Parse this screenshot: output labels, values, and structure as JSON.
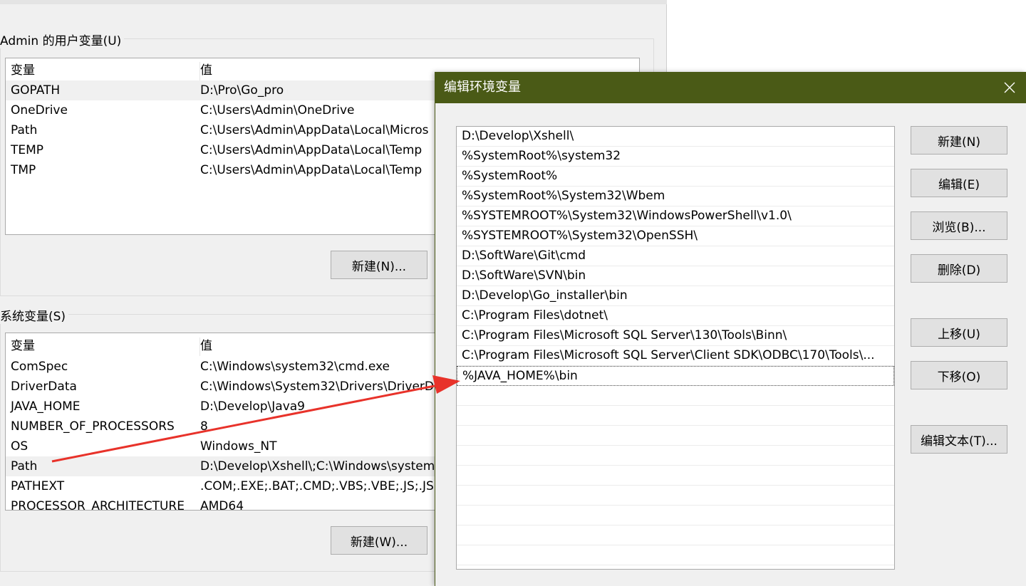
{
  "user_vars": {
    "label": "Admin 的用户变量(U)",
    "header": {
      "name": "变量",
      "value": "值"
    },
    "rows": [
      {
        "name": "GOPATH",
        "value": "D:\\Pro\\Go_pro"
      },
      {
        "name": "OneDrive",
        "value": "C:\\Users\\Admin\\OneDrive"
      },
      {
        "name": "Path",
        "value": "C:\\Users\\Admin\\AppData\\Local\\Micros"
      },
      {
        "name": "TEMP",
        "value": "C:\\Users\\Admin\\AppData\\Local\\Temp"
      },
      {
        "name": "TMP",
        "value": "C:\\Users\\Admin\\AppData\\Local\\Temp"
      }
    ],
    "new_button": "新建(N)..."
  },
  "system_vars": {
    "label": "系统变量(S)",
    "header": {
      "name": "变量",
      "value": "值"
    },
    "rows": [
      {
        "name": "ComSpec",
        "value": "C:\\Windows\\system32\\cmd.exe"
      },
      {
        "name": "DriverData",
        "value": "C:\\Windows\\System32\\Drivers\\DriverD"
      },
      {
        "name": "JAVA_HOME",
        "value": "D:\\Develop\\Java9"
      },
      {
        "name": "NUMBER_OF_PROCESSORS",
        "value": "8"
      },
      {
        "name": "OS",
        "value": "Windows_NT"
      },
      {
        "name": "Path",
        "value": "D:\\Develop\\Xshell\\;C:\\Windows\\system"
      },
      {
        "name": "PATHEXT",
        "value": ".COM;.EXE;.BAT;.CMD;.VBS;.VBE;.JS;.JSE;"
      },
      {
        "name": "PROCESSOR_ARCHITECTURE",
        "value": "AMD64"
      }
    ],
    "new_button": "新建(W)..."
  },
  "edit_dialog": {
    "title": "编辑环境变量",
    "entries": [
      "D:\\Develop\\Xshell\\",
      "%SystemRoot%\\system32",
      "%SystemRoot%",
      "%SystemRoot%\\System32\\Wbem",
      "%SYSTEMROOT%\\System32\\WindowsPowerShell\\v1.0\\",
      "%SYSTEMROOT%\\System32\\OpenSSH\\",
      "D:\\SoftWare\\Git\\cmd",
      "D:\\SoftWare\\SVN\\bin",
      "D:\\Develop\\Go_installer\\bin",
      "C:\\Program Files\\dotnet\\",
      "C:\\Program Files\\Microsoft SQL Server\\130\\Tools\\Binn\\",
      "C:\\Program Files\\Microsoft SQL Server\\Client SDK\\ODBC\\170\\Tools\\...",
      "%JAVA_HOME%\\bin"
    ],
    "buttons": {
      "new": "新建(N)",
      "edit": "编辑(E)",
      "browse": "浏览(B)...",
      "delete": "删除(D)",
      "move_up": "上移(U)",
      "move_down": "下移(O)",
      "edit_text": "编辑文本(T)..."
    }
  },
  "colors": {
    "titlebar": "#4a5a16",
    "arrow": "#e8322a",
    "dialog_bg": "#f0f0f0"
  }
}
